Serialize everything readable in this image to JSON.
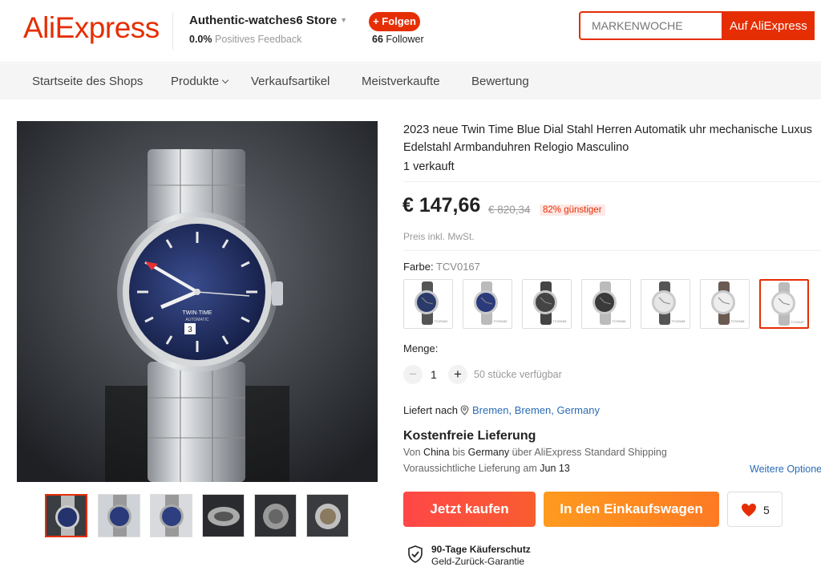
{
  "header": {
    "logo": "AliExpress",
    "store_name": "Authentic-watches6 Store",
    "feedback_value": "0.0%",
    "feedback_label": "Positives Feedback",
    "follow_label": "+ Folgen",
    "followers_count": "66",
    "followers_label": "Follower",
    "search_placeholder": "MARKENWOCHE",
    "search_button": "Auf AliExpress"
  },
  "nav": {
    "items": [
      "Startseite des Shops",
      "Produkte",
      "Verkaufsartikel",
      "Meistverkaufte",
      "Bewertung"
    ]
  },
  "product": {
    "title": "2023 neue Twin Time Blue Dial Stahl Herren Automatik uhr mechanische Luxus Edelstahl Armbanduhren Relogio Masculino",
    "sold": "1 verkauft",
    "price": "€ 147,66",
    "old_price": "€ 820,34",
    "discount": "82% günstiger",
    "tax_note": "Preis inkl. MwSt.",
    "color_label": "Farbe:",
    "color_value": "TCV0167",
    "swatches": [
      {
        "code": "TCV0161",
        "dial": "#2a3a6a",
        "strap": "#555"
      },
      {
        "code": "TCV0162",
        "dial": "#2a3a7a",
        "strap": "#bbb"
      },
      {
        "code": "TCV0163",
        "dial": "#444",
        "strap": "#444"
      },
      {
        "code": "TCV0164",
        "dial": "#3a3a3a",
        "strap": "#bbb"
      },
      {
        "code": "TCV0165",
        "dial": "#e6e6e6",
        "strap": "#555"
      },
      {
        "code": "TCV0166",
        "dial": "#ededed",
        "strap": "#6b5a52"
      },
      {
        "code": "TCV0167",
        "dial": "#f0f0f0",
        "strap": "#bbb"
      }
    ],
    "quantity_label": "Menge:",
    "quantity": "1",
    "availability": "50 stücke verfügbar"
  },
  "shipping": {
    "ship_to_label": "Liefert nach",
    "location": "Bremen, Bremen, Germany",
    "free_shipping": "Kostenfreie Lieferung",
    "from_prefix": "Von",
    "from": "China",
    "to_prefix": "bis",
    "to": "Germany",
    "via_prefix": "über",
    "via": "AliExpress Standard Shipping",
    "delivery_prefix": "Voraussichtliche Lieferung am",
    "delivery_date": "Jun 13",
    "more_options": "Weitere Optionen"
  },
  "actions": {
    "buy_now": "Jetzt kaufen",
    "add_to_cart": "In den Einkaufswagen",
    "wishlist_count": "5"
  },
  "protection": {
    "title": "90-Tage Käuferschutz",
    "subtitle": "Geld-Zurück-Garantie"
  },
  "gallery": {
    "main_watch_text_1": "TWIN·TIME",
    "main_watch_text_2": "AUTOMATIC",
    "main_watch_date": "3",
    "thumbnail_count": 6
  },
  "colors": {
    "brand": "#e62e04",
    "link": "#2a6bb4"
  }
}
